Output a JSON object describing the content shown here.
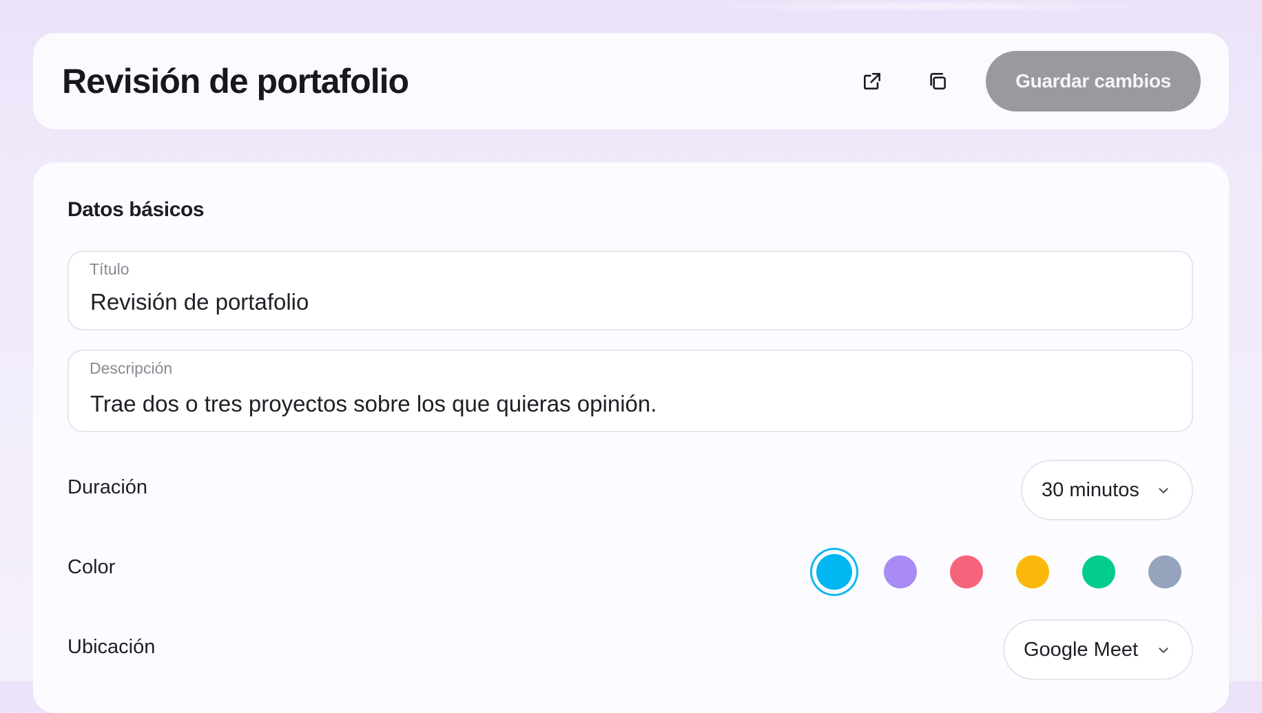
{
  "header": {
    "title": "Revisión de portafolio",
    "open_icon": "external-link-icon",
    "duplicate_icon": "copy-icon",
    "save_label": "Guardar cambios"
  },
  "basics": {
    "section_title": "Datos básicos",
    "title_field": {
      "label": "Título",
      "value": "Revisión de portafolio"
    },
    "description_field": {
      "label": "Descripción",
      "value": "Trae dos o tres proyectos sobre los que quieras opinión."
    },
    "duration": {
      "label": "Duración",
      "selected": "30 minutos"
    },
    "color": {
      "label": "Color",
      "options": [
        "#00b7f1",
        "#a98bf6",
        "#f6647c",
        "#fbb70a",
        "#04cc8c",
        "#96a3bc"
      ],
      "selected_index": 0
    },
    "location": {
      "label": "Ubicación",
      "selected": "Google Meet"
    }
  }
}
